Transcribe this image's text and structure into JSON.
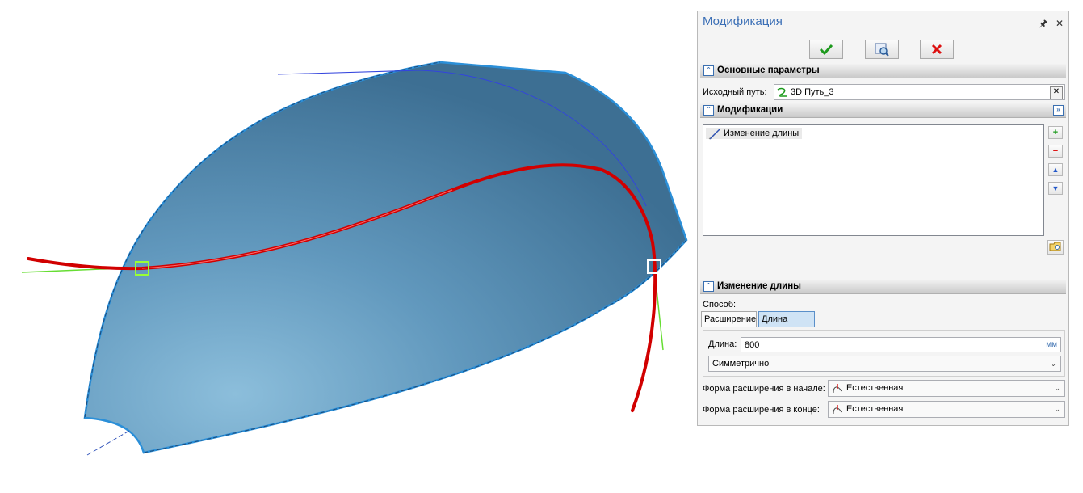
{
  "panel": {
    "title": "Модификация",
    "pin_icon": "pin-icon",
    "close_icon": "close-icon",
    "toolbar": {
      "ok_icon": "checkmark-icon",
      "preview_icon": "preview-icon",
      "cancel_icon": "cross-icon"
    },
    "basic": {
      "header": "Основные параметры",
      "source_label": "Исходный путь:",
      "source_value": "3D Путь_3"
    },
    "mods": {
      "header": "Модификации",
      "items": [
        "Изменение длины"
      ],
      "add_icon": "plus-icon",
      "remove_icon": "minus-icon",
      "up_icon": "arrow-up-icon",
      "down_icon": "arrow-down-icon",
      "folder_icon": "folder-icon"
    },
    "length": {
      "header": "Изменение длины",
      "method_label": "Способ:",
      "tab_extension": "Расширение",
      "tab_length": "Длина",
      "length_label": "Длина:",
      "length_value": "800",
      "length_unit": "мм",
      "mode_value": "Симметрично",
      "start_label": "Форма расширения в начале:",
      "start_value": "Естественная",
      "end_label": "Форма расширения в конце:",
      "end_value": "Естественная"
    }
  },
  "colors": {
    "surface": "#5a8fb4",
    "path": "#d10000",
    "accent": "#3b6fb6",
    "tangent": "#66dd33"
  }
}
